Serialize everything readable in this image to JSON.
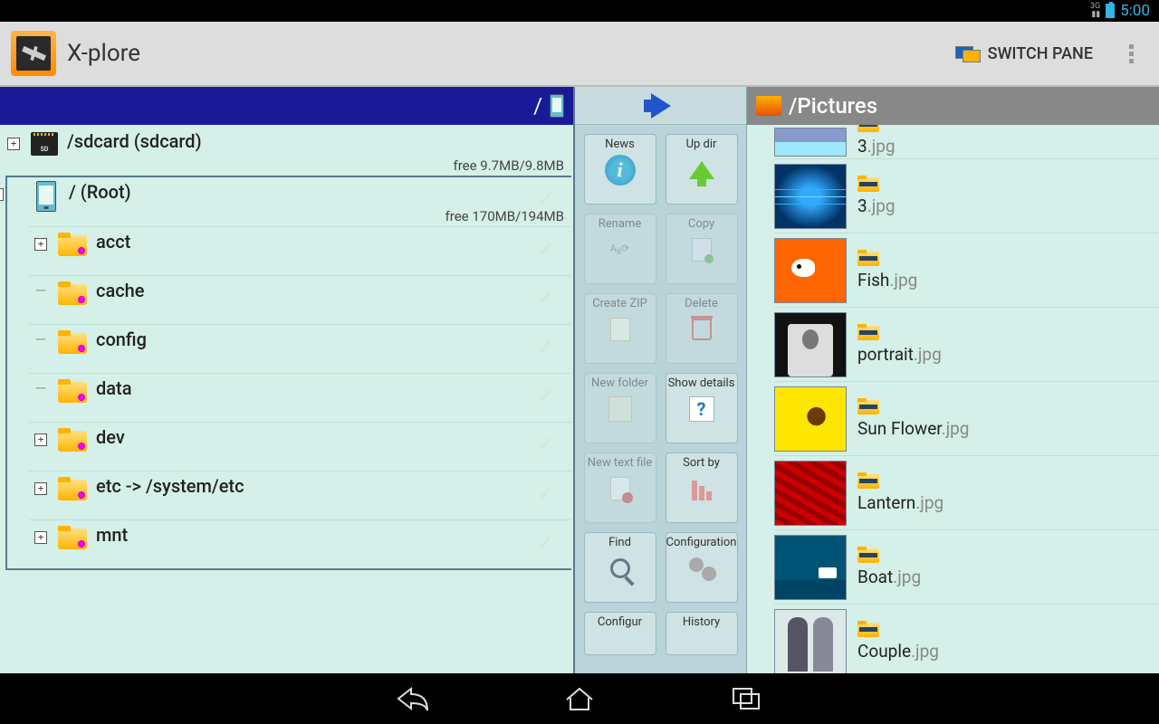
{
  "statusbar": {
    "time": "5:00",
    "network": "3G"
  },
  "actionbar": {
    "title": "X-plore",
    "switch_pane": "SWITCH PANE"
  },
  "left": {
    "header_path": "/",
    "sdcard": {
      "label": "/sdcard (sdcard)",
      "free": "free 9.7MB/9.8MB"
    },
    "root": {
      "label": "/ (Root)",
      "free": "free 170MB/194MB"
    },
    "folders": [
      {
        "name": "acct",
        "toggle": "+"
      },
      {
        "name": "cache",
        "toggle": "-"
      },
      {
        "name": "config",
        "toggle": "-"
      },
      {
        "name": "data",
        "toggle": "-"
      },
      {
        "name": "dev",
        "toggle": "+"
      },
      {
        "name": "etc -> /system/etc",
        "toggle": "+"
      },
      {
        "name": "mnt",
        "toggle": "+"
      }
    ]
  },
  "center": {
    "buttons": [
      {
        "label": "News",
        "enabled": true,
        "icon": "info"
      },
      {
        "label": "Up dir",
        "enabled": true,
        "icon": "up"
      },
      {
        "label": "Rename",
        "enabled": false,
        "icon": "rename"
      },
      {
        "label": "Copy",
        "enabled": false,
        "icon": "copy"
      },
      {
        "label": "Create ZIP",
        "enabled": false,
        "icon": "zip"
      },
      {
        "label": "Delete",
        "enabled": false,
        "icon": "trash"
      },
      {
        "label": "New folder",
        "enabled": false,
        "icon": "newfolder"
      },
      {
        "label": "Show details",
        "enabled": true,
        "icon": "details"
      },
      {
        "label": "New text file",
        "enabled": false,
        "icon": "newtext"
      },
      {
        "label": "Sort by",
        "enabled": true,
        "icon": "sort"
      },
      {
        "label": "Find",
        "enabled": true,
        "icon": "find"
      },
      {
        "label": "Configuration",
        "enabled": true,
        "icon": "config"
      },
      {
        "label": "Configur",
        "enabled": true,
        "icon": "",
        "short": true
      },
      {
        "label": "History",
        "enabled": true,
        "icon": "",
        "short": true
      }
    ]
  },
  "right": {
    "header": "/Pictures",
    "items": [
      {
        "name": "3",
        "ext": ".jpg",
        "thumb": "t-sky",
        "first": true
      },
      {
        "name": "3",
        "ext": ".jpg",
        "thumb": "t-bridge"
      },
      {
        "name": "Fish",
        "ext": ".jpg",
        "thumb": "t-fish"
      },
      {
        "name": "portrait",
        "ext": ".jpg",
        "thumb": "t-portrait"
      },
      {
        "name": "Sun Flower",
        "ext": ".jpg",
        "thumb": "t-sun"
      },
      {
        "name": "Lantern",
        "ext": ".jpg",
        "thumb": "t-lantern"
      },
      {
        "name": "Boat",
        "ext": ".jpg",
        "thumb": "t-boat"
      },
      {
        "name": "Couple",
        "ext": ".jpg",
        "thumb": "t-couple"
      }
    ]
  }
}
